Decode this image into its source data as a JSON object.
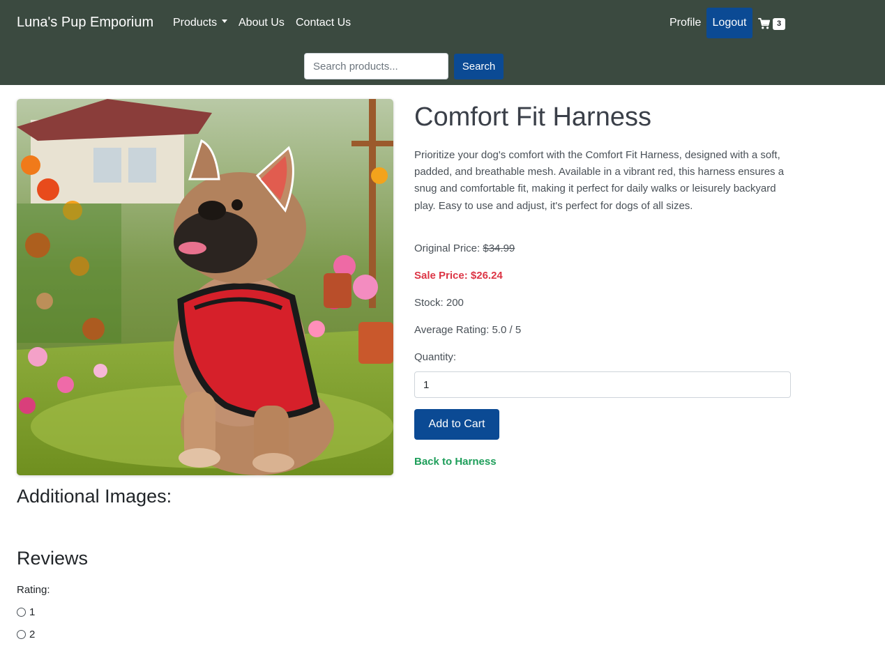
{
  "navbar": {
    "brand": "Luna's Pup Emporium",
    "links": {
      "products": "Products",
      "about": "About Us",
      "contact": "Contact Us",
      "profile": "Profile"
    },
    "logout": "Logout",
    "cart_count": "3",
    "search": {
      "placeholder": "Search products...",
      "button": "Search"
    }
  },
  "product": {
    "title": "Comfort Fit Harness",
    "description": "Prioritize your dog's comfort with the Comfort Fit Harness, designed with a soft, padded, and breathable mesh. Available in a vibrant red, this harness ensures a snug and comfortable fit, making it perfect for daily walks or leisurely backyard play. Easy to use and adjust, it's perfect for dogs of all sizes.",
    "original_price_label": "Original Price:",
    "original_price": "$34.99",
    "sale_price": "Sale Price: $26.24",
    "stock": "Stock: 200",
    "average_rating": "Average Rating: 5.0 / 5",
    "quantity_label": "Quantity:",
    "quantity_value": "1",
    "add_to_cart": "Add to Cart",
    "back_link": "Back to Harness"
  },
  "sections": {
    "additional_images": "Additional Images:",
    "reviews": "Reviews",
    "rating_label": "Rating:",
    "rating_options": [
      "1",
      "2"
    ]
  },
  "colors": {
    "navbar_bg": "#3b4a40",
    "primary": "#0b4a94",
    "sale": "#dc3545",
    "link_green": "#1e9e5a"
  },
  "icons": {
    "cart": "cart-icon",
    "caret": "caret-down-icon"
  }
}
